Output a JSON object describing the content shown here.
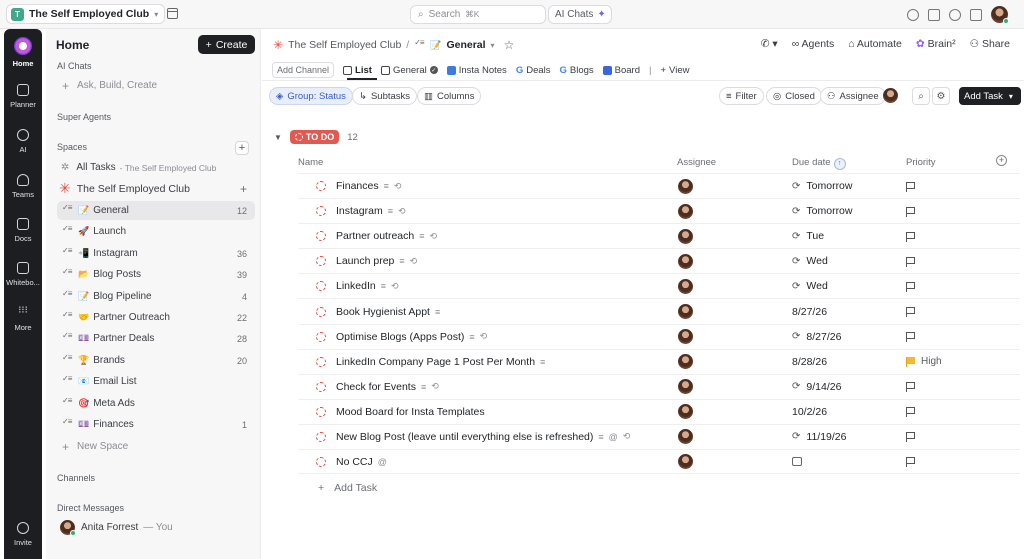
{
  "topbar": {
    "workspace_initial": "T",
    "workspace_name": "The Self Employed Club",
    "search_placeholder": "Search",
    "search_shortcut": "⌘K",
    "ai_chats": "AI Chats"
  },
  "rail": [
    {
      "label": "Home"
    },
    {
      "label": "Planner"
    },
    {
      "label": "AI"
    },
    {
      "label": "Teams"
    },
    {
      "label": "Docs"
    },
    {
      "label": "Whitebo..."
    },
    {
      "label": "More"
    },
    {
      "label": "Invite"
    }
  ],
  "sidebar": {
    "title": "Home",
    "create_label": "Create",
    "ai_chats_section": "AI Chats",
    "ask_placeholder": "Ask, Build, Create",
    "super_agents": "Super Agents",
    "spaces_section": "Spaces",
    "all_tasks": "All Tasks",
    "all_tasks_suffix": "- The Self Employed Club",
    "space_name": "The Self Employed Club",
    "lists": [
      {
        "emoji": "📝",
        "name": "General",
        "count": "12"
      },
      {
        "emoji": "🚀",
        "name": "Launch",
        "count": ""
      },
      {
        "emoji": "📲",
        "name": "Instagram",
        "count": "36"
      },
      {
        "emoji": "📂",
        "name": "Blog Posts",
        "count": "39"
      },
      {
        "emoji": "📝",
        "name": "Blog Pipeline",
        "count": "4"
      },
      {
        "emoji": "🤝",
        "name": "Partner Outreach",
        "count": "22"
      },
      {
        "emoji": "💷",
        "name": "Partner Deals",
        "count": "28"
      },
      {
        "emoji": "🏆",
        "name": "Brands",
        "count": "20"
      },
      {
        "emoji": "📧",
        "name": "Email List",
        "count": ""
      },
      {
        "emoji": "🎯",
        "name": "Meta Ads",
        "count": ""
      },
      {
        "emoji": "💷",
        "name": "Finances",
        "count": "1"
      }
    ],
    "new_space": "New Space",
    "channels": "Channels",
    "direct_messages": "Direct Messages",
    "dm_user": "Anita Forrest",
    "dm_you": "— You"
  },
  "main": {
    "breadcrumb_space": "The Self Employed Club",
    "breadcrumb_list": "General",
    "header_actions": [
      "Agents",
      "Automate",
      "Brain²",
      "Share"
    ],
    "add_channel": "Add Channel",
    "tabs": [
      {
        "label": "List",
        "icon": "list-icon",
        "color": "#444444"
      },
      {
        "label": "General",
        "icon": "doc-icon",
        "color": "#444444"
      },
      {
        "label": "Insta Notes",
        "icon": "doc-icon",
        "color": "#3d7be0"
      },
      {
        "label": "Deals",
        "icon": "google-icon",
        "color": "#4285f4"
      },
      {
        "label": "Blogs",
        "icon": "google-icon",
        "color": "#4285f4"
      },
      {
        "label": "Board",
        "icon": "board-icon",
        "color": "#3b66d9"
      }
    ],
    "view_label": "View",
    "group_label": "Group: Status",
    "subtasks_label": "Subtasks",
    "columns_label": "Columns",
    "filter_label": "Filter",
    "closed_label": "Closed",
    "assignee_label": "Assignee",
    "add_task_btn": "Add Task",
    "group_status": "TO DO",
    "group_count": "12",
    "col_name": "Name",
    "col_assignee": "Assignee",
    "col_due": "Due date",
    "col_priority": "Priority",
    "tasks": [
      {
        "name": "Finances",
        "desc": true,
        "recur": true,
        "attach": false,
        "due": "Tomorrow",
        "due_recur": true,
        "priority": ""
      },
      {
        "name": "Instagram",
        "desc": true,
        "recur": true,
        "attach": false,
        "due": "Tomorrow",
        "due_recur": true,
        "priority": ""
      },
      {
        "name": "Partner outreach",
        "desc": true,
        "recur": true,
        "attach": false,
        "due": "Tue",
        "due_recur": true,
        "priority": ""
      },
      {
        "name": "Launch prep",
        "desc": true,
        "recur": true,
        "attach": false,
        "due": "Wed",
        "due_recur": true,
        "priority": ""
      },
      {
        "name": "LinkedIn",
        "desc": true,
        "recur": true,
        "attach": false,
        "due": "Wed",
        "due_recur": true,
        "priority": ""
      },
      {
        "name": "Book Hygienist Appt",
        "desc": true,
        "recur": false,
        "attach": false,
        "due": "8/27/26",
        "due_recur": false,
        "priority": ""
      },
      {
        "name": "Optimise Blogs (Apps Post)",
        "desc": true,
        "recur": true,
        "attach": false,
        "due": "8/27/26",
        "due_recur": true,
        "priority": ""
      },
      {
        "name": "LinkedIn Company Page 1 Post Per Month",
        "desc": true,
        "recur": false,
        "attach": false,
        "due": "8/28/26",
        "due_recur": false,
        "priority": "High"
      },
      {
        "name": "Check for Events",
        "desc": true,
        "recur": true,
        "attach": false,
        "due": "9/14/26",
        "due_recur": true,
        "priority": ""
      },
      {
        "name": "Mood Board for Insta Templates",
        "desc": false,
        "recur": false,
        "attach": false,
        "due": "10/2/26",
        "due_recur": false,
        "priority": ""
      },
      {
        "name": "New Blog Post (leave until everything else is refreshed)",
        "desc": true,
        "recur": true,
        "attach": true,
        "due": "11/19/26",
        "due_recur": true,
        "priority": ""
      },
      {
        "name": "No CCJ",
        "desc": false,
        "recur": false,
        "attach": true,
        "due": "",
        "due_recur": false,
        "priority": ""
      }
    ],
    "add_task_row": "Add Task"
  },
  "colors": {
    "accent_dark": "#1f2023",
    "todo_red": "#e15a51",
    "high_flag": "#f5b82e",
    "group_blue": "#3b5bcc"
  }
}
